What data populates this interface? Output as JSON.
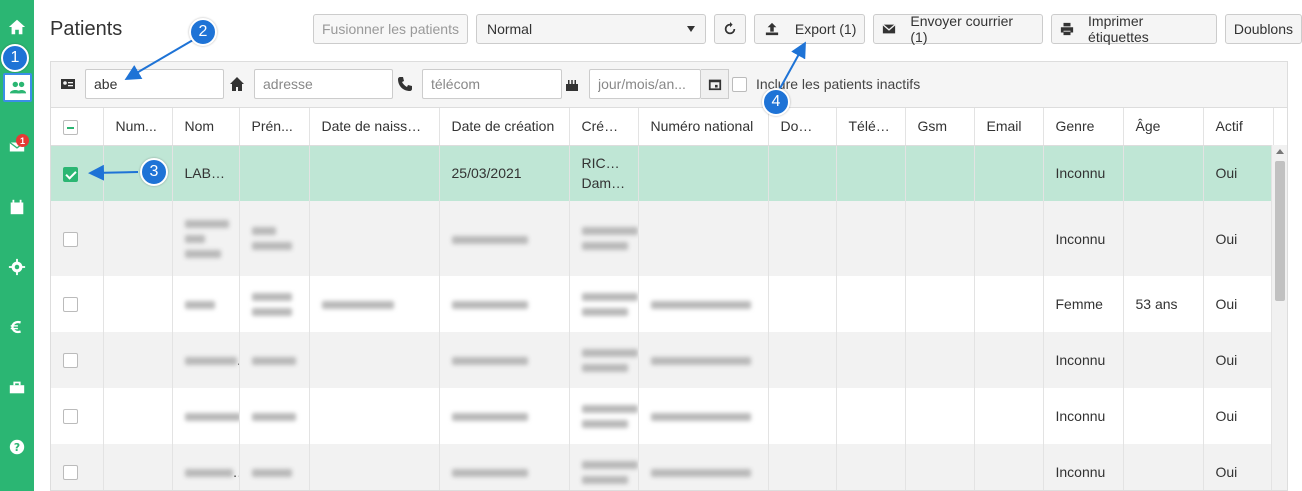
{
  "sidebar": {
    "badge": "1",
    "icons": [
      "home-icon",
      "users-icon",
      "mail-icon",
      "calendar-icon",
      "gear-icon",
      "euro-icon",
      "toolbox-icon",
      "help-icon"
    ]
  },
  "header": {
    "title": "Patients",
    "merge_label": "Fusionner les patients",
    "view_select": "Normal",
    "export_label": "Export (1)",
    "mail_label": "Envoyer courrier (1)",
    "print_label": "Imprimer étiquettes",
    "duplicates_label": "Doublons"
  },
  "filters": {
    "name_value": "abe",
    "address_placeholder": "adresse",
    "phone_placeholder": "télécom",
    "date_placeholder": "jour/mois/an...",
    "inactive_label": "Inclure les patients inactifs"
  },
  "table": {
    "columns": [
      "Num...",
      "Nom",
      "Prén...",
      "Date de naissa...",
      "Date de création",
      "Créé ...",
      "Numéro national",
      "Domi...",
      "Télép...",
      "Gsm",
      "Email",
      "Genre",
      "Âge",
      "Actif"
    ],
    "selected_row": {
      "nom": "LABEYE",
      "date_creation": "25/03/2021",
      "cree_par_1": "RICHARD",
      "cree_par_2": "Damien",
      "genre": "Inconnu",
      "actif": "Oui"
    },
    "rows": [
      {
        "genre": "Inconnu",
        "age": "",
        "actif": "Oui"
      },
      {
        "genre": "Femme",
        "age": "53 ans",
        "actif": "Oui"
      },
      {
        "genre": "Inconnu",
        "age": "",
        "actif": "Oui"
      },
      {
        "genre": "Inconnu",
        "age": "",
        "actif": "Oui"
      },
      {
        "genre": "Inconnu",
        "age": "",
        "actif": "Oui"
      }
    ]
  },
  "annotations": [
    "1",
    "2",
    "3",
    "4"
  ],
  "colors": {
    "sidebar": "#2bb673",
    "selected_row": "#bfe6d5",
    "marker": "#1e73d6"
  }
}
